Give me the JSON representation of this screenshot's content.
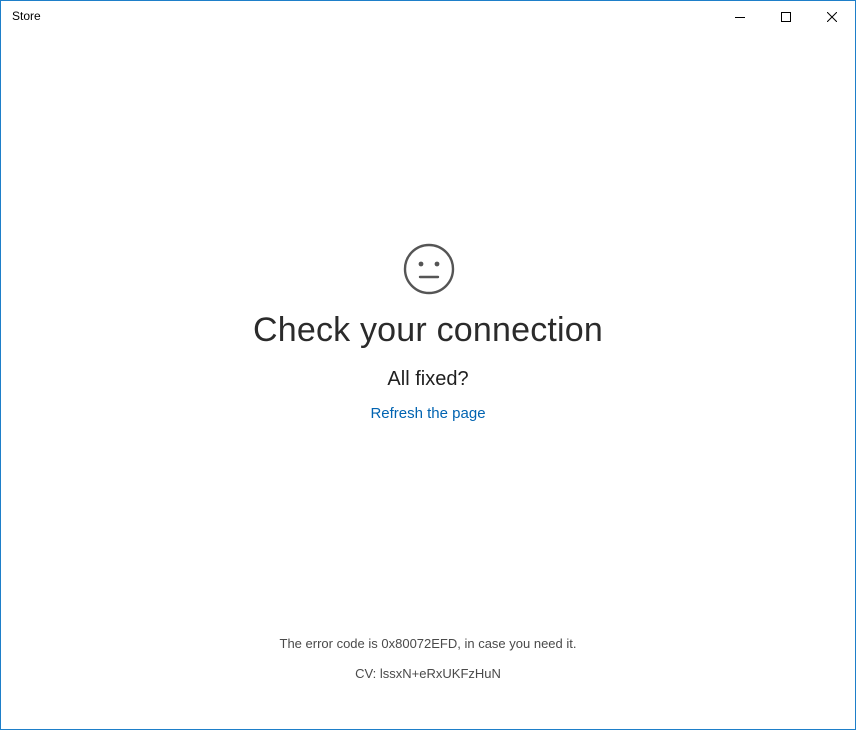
{
  "window": {
    "title": "Store",
    "controls": {
      "minimize_icon": "minimize-icon",
      "maximize_icon": "maximize-icon",
      "close_icon": "close-icon"
    },
    "border_color": "#1e7fc9"
  },
  "error_page": {
    "icon": "neutral-face-icon",
    "headline": "Check your connection",
    "subhead": "All fixed?",
    "refresh_link": "Refresh the page",
    "error_code_text": "The error code is 0x80072EFD, in case you need it.",
    "cv_text": "CV: lssxN+eRxUKFzHuN",
    "link_color": "#0063b1"
  }
}
